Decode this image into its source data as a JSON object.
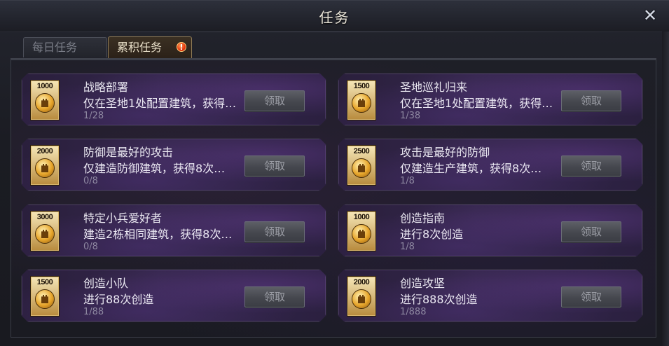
{
  "window": {
    "title": "任务",
    "close_glyph": "✕"
  },
  "tabs": [
    {
      "label": "每日任务",
      "active": false
    },
    {
      "label": "累积任务",
      "active": true,
      "badge": "!"
    }
  ],
  "tasks": [
    {
      "reward": "1000",
      "name": "战略部署",
      "desc": "仅在圣地1处配置建筑，获得…",
      "progress": "1/28",
      "button": "领取"
    },
    {
      "reward": "1500",
      "name": "圣地巡礼归来",
      "desc": "仅在圣地1处配置建筑，获得…",
      "progress": "1/38",
      "button": "领取"
    },
    {
      "reward": "2000",
      "name": "防御是最好的攻击",
      "desc": "仅建造防御建筑，获得8次…",
      "progress": "0/8",
      "button": "领取"
    },
    {
      "reward": "2500",
      "name": "攻击是最好的防御",
      "desc": "仅建造生产建筑，获得8次…",
      "progress": "1/8",
      "button": "领取"
    },
    {
      "reward": "3000",
      "name": "特定小兵爱好者",
      "desc": "建造2栋相同建筑，获得8次…",
      "progress": "0/8",
      "button": "领取"
    },
    {
      "reward": "1000",
      "name": "创造指南",
      "desc": "进行8次创造",
      "progress": "1/8",
      "button": "领取"
    },
    {
      "reward": "1500",
      "name": "创造小队",
      "desc": "进行88次创造",
      "progress": "1/88",
      "button": "领取"
    },
    {
      "reward": "2000",
      "name": "创造攻坚",
      "desc": "进行888次创造",
      "progress": "1/888",
      "button": "领取"
    }
  ],
  "colors": {
    "card_purple": "#33264a",
    "title_text": "#e9e4d8",
    "badge_orange": "#e6360d"
  },
  "icons": {
    "close": "close-icon",
    "badge": "alert-badge-icon",
    "reward": "gold-coin-icon"
  }
}
